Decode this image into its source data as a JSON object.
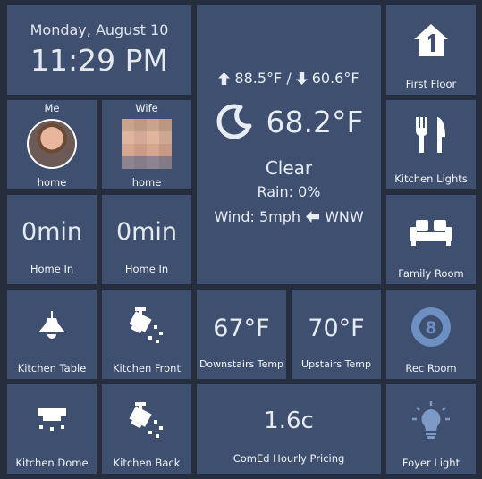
{
  "clock": {
    "date": "Monday, August 10",
    "time": "11:29 PM"
  },
  "people": [
    {
      "name": "Me",
      "status": "home"
    },
    {
      "name": "Wife",
      "status": "home"
    }
  ],
  "home_in": [
    {
      "value": "0min",
      "label": "Home In"
    },
    {
      "value": "0min",
      "label": "Home In"
    }
  ],
  "weather": {
    "high": "88.5°F /",
    "low": "60.6°F",
    "temp": "68.2°F",
    "condition": "Clear",
    "rain": "Rain: 0%",
    "wind": "Wind: 5mph",
    "wind_dir": "WNW",
    "icon": "moon-icon"
  },
  "right_tiles": [
    {
      "label": "First Floor",
      "icon": "home-1-icon"
    },
    {
      "label": "Kitchen Lights",
      "icon": "fork-knife-icon"
    },
    {
      "label": "Family Room",
      "icon": "couch-icon"
    },
    {
      "label": "Rec Room",
      "icon": "billiard-8-ball-icon"
    },
    {
      "label": "Foyer Light",
      "icon": "lightbulb-icon"
    }
  ],
  "lights": [
    {
      "label": "Kitchen Table",
      "icon": "pendant-lamp-icon"
    },
    {
      "label": "Kitchen Front",
      "icon": "spotlight-icon"
    },
    {
      "label": "Kitchen Dome",
      "icon": "ceiling-light-icon"
    },
    {
      "label": "Kitchen Back",
      "icon": "spotlight-icon"
    }
  ],
  "temps": [
    {
      "value": "67°F",
      "label": "Downstairs Temp"
    },
    {
      "value": "70°F",
      "label": "Upstairs Temp"
    }
  ],
  "pricing": {
    "value": "1.6c",
    "label": "ComEd Hourly Pricing"
  },
  "colors": {
    "background": "#262d3c",
    "tile": "#3e4f6f",
    "text": "#e8ecf3",
    "foyer_icon": "#7d9ac7",
    "rec_icon": "#6d8fc2"
  }
}
